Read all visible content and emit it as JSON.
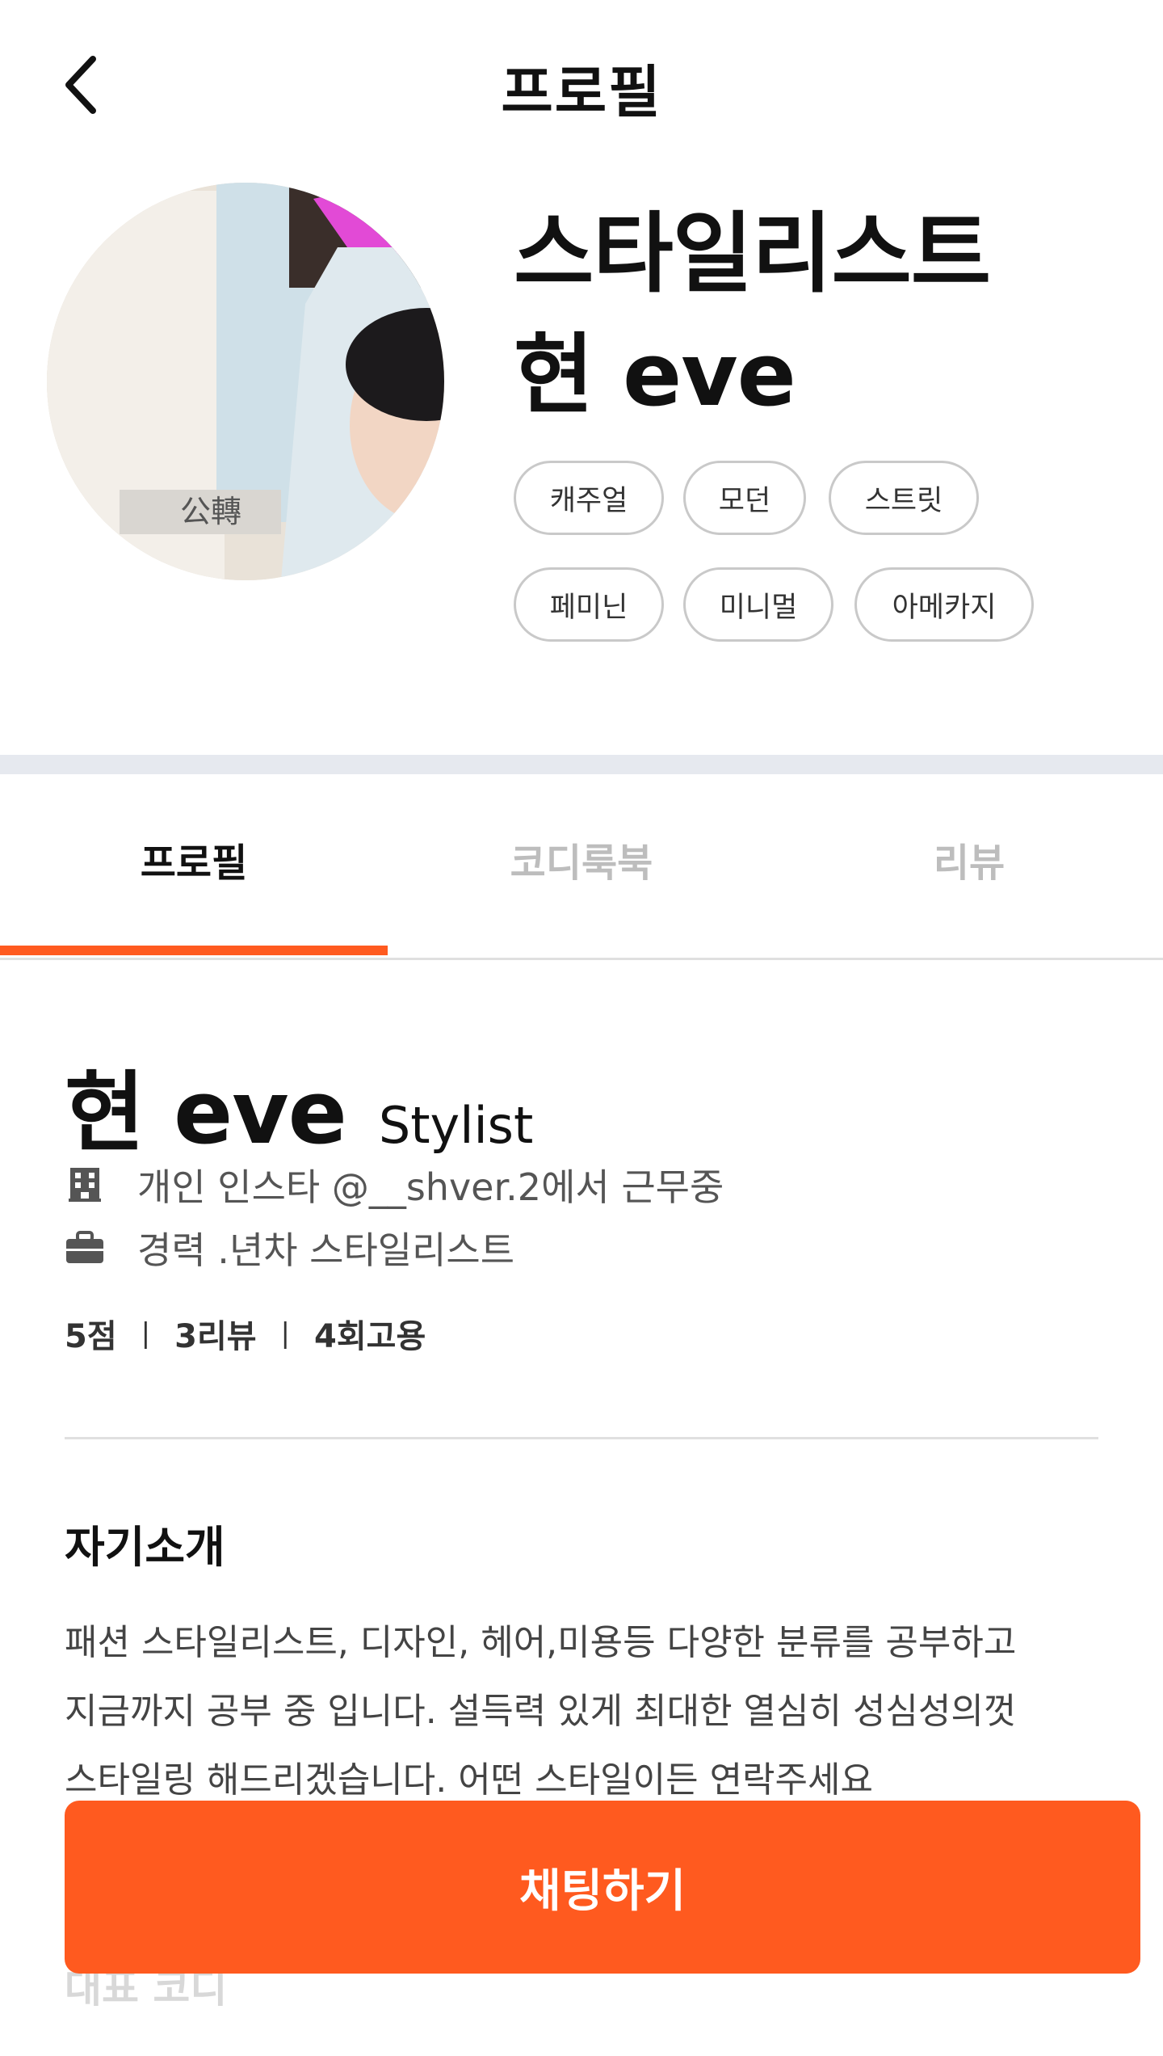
{
  "header": {
    "title": "프로필"
  },
  "profile_card": {
    "name": "스타일리스트\n현 eve",
    "tags": [
      "캐주얼",
      "모던",
      "스트릿",
      "페미닌",
      "미니멀",
      "아메카지"
    ]
  },
  "tabs": [
    {
      "label": "프로필",
      "active": true
    },
    {
      "label": "코디룩북",
      "active": false
    },
    {
      "label": "리뷰",
      "active": false
    }
  ],
  "details": {
    "name": "현 eve",
    "role": "Stylist",
    "workplace": "개인 인스타 @__shver.2에서 근무중",
    "career": "경력 .년차 스타일리스트",
    "stats": {
      "score": "5점",
      "reviews": "3리뷰",
      "hires": "4회고용"
    }
  },
  "intro": {
    "title": "자기소개",
    "lines": [
      "패션 스타일리스트, 디자인, 헤어,미용등 다양한 분류를 공부하고",
      "지금까지 공부 중 입니다. 설득력 있게 최대한 열심히 성심성의껏",
      "스타일링 해드리겠습니다. 어떤 스타일이든 연락주세요"
    ]
  },
  "next_section": {
    "title": "대표 코디"
  },
  "cta": {
    "label": "채팅하기"
  },
  "colors": {
    "accent": "#ff5a1f",
    "divider": "#e6e9ef",
    "tag_border": "#c9c9c9"
  }
}
